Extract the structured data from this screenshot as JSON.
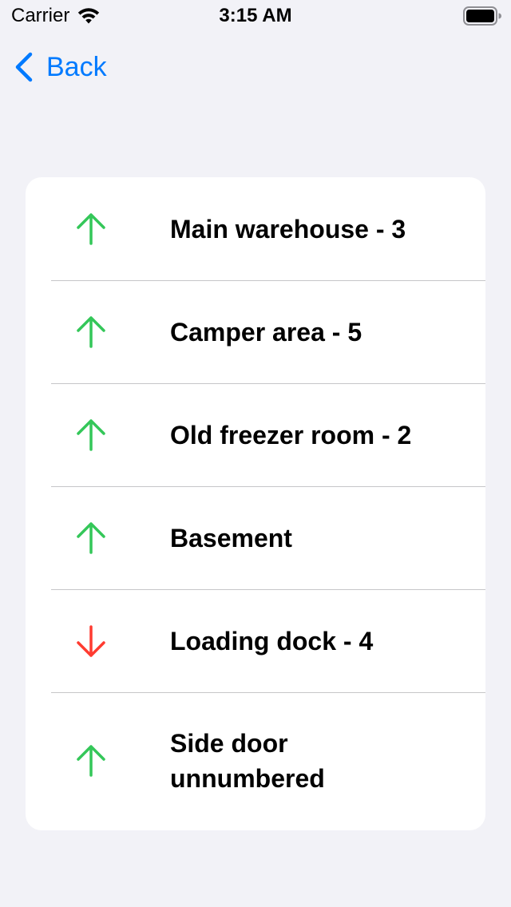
{
  "status_bar": {
    "carrier": "Carrier",
    "time": "3:15 AM",
    "icons": [
      "wifi-icon",
      "battery-icon"
    ]
  },
  "nav": {
    "back_label": "Back",
    "accent_color": "#007aff"
  },
  "colors": {
    "up": "#34c759",
    "down": "#ff3b30",
    "background": "#f2f2f7",
    "card": "#ffffff"
  },
  "items": [
    {
      "label": "Main warehouse - 3",
      "direction": "up",
      "icon": "arrow-up-icon"
    },
    {
      "label": "Camper area - 5",
      "direction": "up",
      "icon": "arrow-up-icon"
    },
    {
      "label": "Old freezer room - 2",
      "direction": "up",
      "icon": "arrow-up-icon"
    },
    {
      "label": "Basement",
      "direction": "up",
      "icon": "arrow-up-icon"
    },
    {
      "label": "Loading dock - 4",
      "direction": "down",
      "icon": "arrow-down-icon"
    },
    {
      "label": "Side door unnumbered",
      "direction": "up",
      "icon": "arrow-up-icon"
    }
  ]
}
